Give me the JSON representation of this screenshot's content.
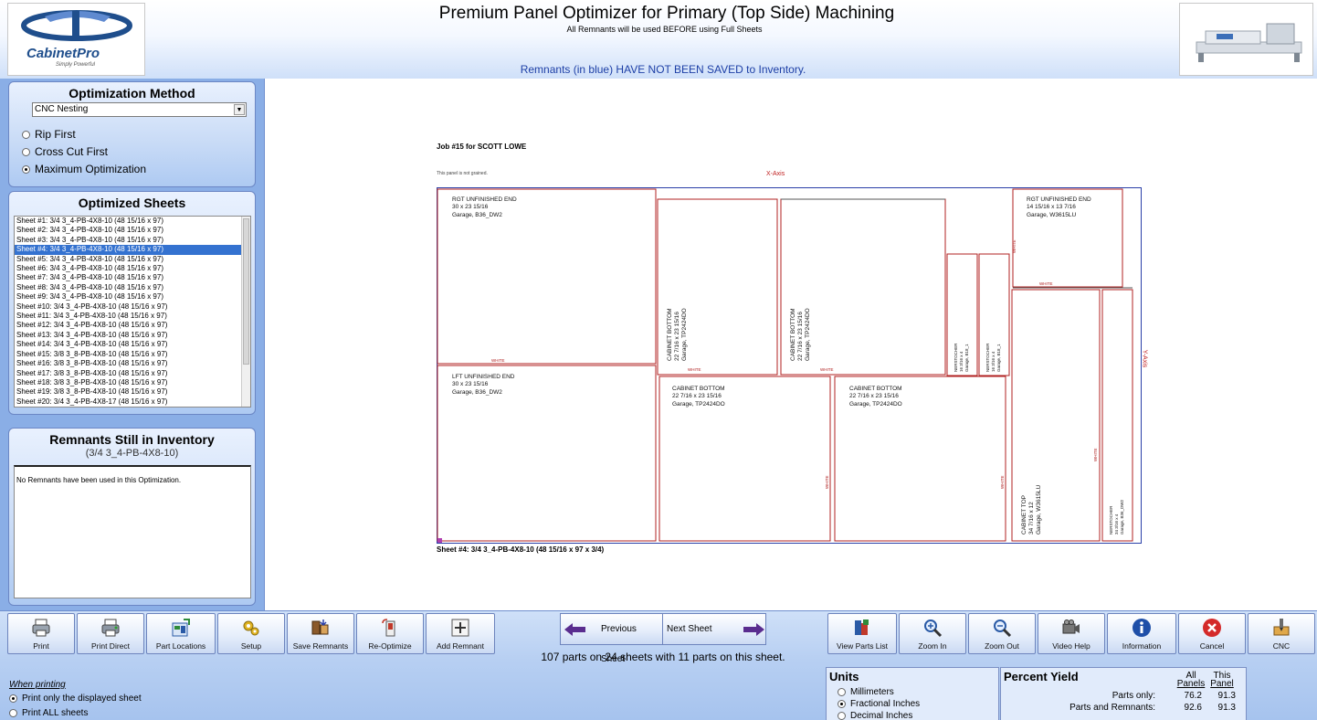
{
  "header": {
    "title": "Premium Panel Optimizer for Primary (Top Side) Machining",
    "subtitle": "All Remnants will be used BEFORE using Full Sheets",
    "remnant_warning": "Remnants (in blue) HAVE NOT BEEN SAVED to Inventory.",
    "logo_text": "CabinetPro",
    "logo_tagline": "Simply Powerful"
  },
  "optimization_method": {
    "title": "Optimization Method",
    "selected": "CNC Nesting",
    "options": [
      "Rip First",
      "Cross Cut First",
      "Maximum Optimization"
    ],
    "selected_option": "Maximum Optimization"
  },
  "optimized_sheets": {
    "title": "Optimized Sheets",
    "items": [
      "Sheet #1: 3/4 3_4-PB-4X8-10 (48 15/16 x 97)",
      "Sheet #2: 3/4 3_4-PB-4X8-10 (48 15/16 x 97)",
      "Sheet #3: 3/4 3_4-PB-4X8-10 (48 15/16 x 97)",
      "Sheet #4: 3/4 3_4-PB-4X8-10 (48 15/16 x 97)",
      "Sheet #5: 3/4 3_4-PB-4X8-10 (48 15/16 x 97)",
      "Sheet #6: 3/4 3_4-PB-4X8-10 (48 15/16 x 97)",
      "Sheet #7: 3/4 3_4-PB-4X8-10 (48 15/16 x 97)",
      "Sheet #8: 3/4 3_4-PB-4X8-10 (48 15/16 x 97)",
      "Sheet #9: 3/4 3_4-PB-4X8-10 (48 15/16 x 97)",
      "Sheet #10: 3/4 3_4-PB-4X8-10 (48 15/16 x 97)",
      "Sheet #11: 3/4 3_4-PB-4X8-10 (48 15/16 x 97)",
      "Sheet #12: 3/4 3_4-PB-4X8-10 (48 15/16 x 97)",
      "Sheet #13: 3/4 3_4-PB-4X8-10 (48 15/16 x 97)",
      "Sheet #14: 3/4 3_4-PB-4X8-10 (48 15/16 x 97)",
      "Sheet #15: 3/8 3_8-PB-4X8-10 (48 15/16 x 97)",
      "Sheet #16: 3/8 3_8-PB-4X8-10 (48 15/16 x 97)",
      "Sheet #17: 3/8 3_8-PB-4X8-10 (48 15/16 x 97)",
      "Sheet #18: 3/8 3_8-PB-4X8-10 (48 15/16 x 97)",
      "Sheet #19: 3/8 3_8-PB-4X8-10 (48 15/16 x 97)",
      "Sheet #20: 3/4 3_4-PB-4X8-17 (48 15/16 x 97)"
    ],
    "selected_index": 3
  },
  "remnants": {
    "title": "Remnants Still in Inventory",
    "subtitle": "(3/4 3_4-PB-4X8-10)",
    "message": "No Remnants have been used in this Optimization."
  },
  "drawing": {
    "job_title": "Job #15 for SCOTT LOWE",
    "panel_note": "This panel is not grained.",
    "x_axis": "X-Axis",
    "y_axis": "Y-Axis",
    "sheet_caption": "Sheet #4:  3/4 3_4-PB-4X8-10 (48 15/16 x 97 x 3/4)",
    "edge_label": "WHITE",
    "parts": [
      {
        "name": "RGT UNFINISHED END",
        "size": "30 x 23 15/16",
        "garage": "Garage, B36_DW2"
      },
      {
        "name": "LFT UNFINISHED END",
        "size": "30 x 23 15/16",
        "garage": "Garage, B36_DW2"
      },
      {
        "name": "CABINET BOTTOM",
        "size": "22 7/16 x 23 15/16",
        "garage": "Garage, TP2424DO"
      },
      {
        "name": "CABINET BOTTOM",
        "size": "22 7/16 x 23 15/16",
        "garage": "Garage, TP2424DO"
      },
      {
        "name": "CABINET BOTTOM",
        "size": "22 7/16 x 23 15/16",
        "garage": "Garage, TP2424DO"
      },
      {
        "name": "CABINET BOTTOM",
        "size": "22 7/16 x 23 15/16",
        "garage": "Garage, TP2424DO"
      },
      {
        "name": "RGT UNFINISHED END",
        "size": "14 15/16 x 13 7/16",
        "garage": "Garage, W3615LU"
      },
      {
        "name": "NERSTOCHER",
        "size": "16 3/16 x 4",
        "garage": "Garage, B18_1"
      },
      {
        "name": "NERSTOCHER",
        "size": "16 3/16 x 4",
        "garage": "Garage, B18_1"
      },
      {
        "name": "CABINET TOP",
        "size": "34 7/16 x 12",
        "garage": "Garage, W3615LU"
      },
      {
        "name": "NERSTOCHER",
        "size": "34 3/16 x 4",
        "garage": "Garage, B36_DW2"
      }
    ]
  },
  "toolbar": {
    "print": "Print",
    "print_direct": "Print Direct",
    "part_locations": "Part Locations",
    "setup": "Setup",
    "save_remnants": "Save Remnants",
    "re_optimize": "Re-Optimize",
    "add_remnant": "Add Remnant",
    "previous_sheet": "Previous Sheet",
    "next_sheet": "Next Sheet",
    "view_parts_list": "View Parts List",
    "zoom_in": "Zoom In",
    "zoom_out": "Zoom Out",
    "video_help": "Video Help",
    "information": "Information",
    "cancel": "Cancel",
    "cnc": "CNC"
  },
  "summary": "107 parts on 24 sheets with 11 parts on this sheet.",
  "print_options": {
    "header": "When printing",
    "options": [
      "Print only the displayed sheet",
      "Print ALL sheets"
    ],
    "selected": "Print only the displayed sheet"
  },
  "units": {
    "title": "Units",
    "options": [
      "Millimeters",
      "Fractional Inches",
      "Decimal Inches"
    ],
    "selected": "Fractional Inches"
  },
  "yield": {
    "title": "Percent Yield",
    "col_all_1": "All",
    "col_all_2": "Panels",
    "col_this_1": "This",
    "col_this_2": "Panel",
    "row_parts": "Parts only:",
    "row_parts_rem": "Parts and Remnants:",
    "parts_all": "76.2",
    "parts_this": "91.3",
    "rem_all": "92.6",
    "rem_this": "91.3"
  },
  "colors": {
    "panel_blue": "#8aaee6",
    "part_outline": "#b02020",
    "sheet_outline": "#2a3fa8",
    "selected_row": "#3472d0"
  }
}
